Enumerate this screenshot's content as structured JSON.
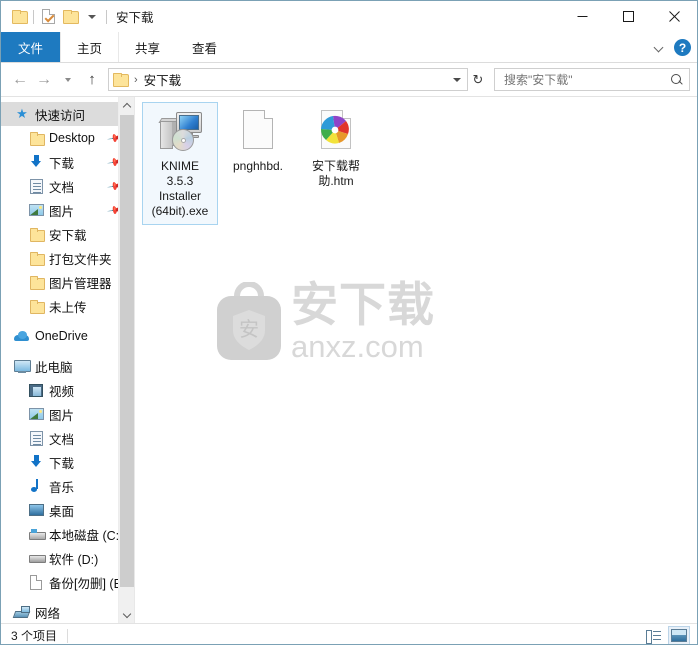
{
  "window": {
    "title": "安下载",
    "quick_access": [
      {
        "name": "folder-icon",
        "label": "文件夹"
      },
      {
        "name": "properties-icon",
        "label": "属性"
      },
      {
        "name": "new-folder-icon",
        "label": "新建文件夹"
      }
    ],
    "controls": {
      "minimize": "—",
      "maximize": "☐",
      "close": "✕"
    }
  },
  "ribbon": {
    "tabs": [
      {
        "label": "文件",
        "active": true
      },
      {
        "label": "主页",
        "active": false
      },
      {
        "label": "共享",
        "active": false
      },
      {
        "label": "查看",
        "active": false
      }
    ],
    "collapse_icon": "chevron-down-icon",
    "help_icon": "help-icon",
    "help_glyph": "?"
  },
  "navbar": {
    "back": "←",
    "forward": "→",
    "recent": "recent-locations-icon",
    "up": "↑",
    "breadcrumb": [
      "安下载"
    ],
    "breadcrumb_separator": "›",
    "dropdown_icon": "chevron-down-icon",
    "refresh_icon": "↻",
    "refresh_glyph": "↻"
  },
  "search": {
    "value": "",
    "placeholder": "搜索\"安下载\"",
    "icon": "search-icon"
  },
  "sidebar": {
    "items": [
      {
        "label": "快速访问",
        "icon": "star-pin-icon",
        "level": 0,
        "selected": true,
        "pinned": false
      },
      {
        "label": "Desktop",
        "icon": "folder-icon",
        "level": 1,
        "selected": false,
        "pinned": true
      },
      {
        "label": "下载",
        "icon": "downloads-icon",
        "level": 1,
        "selected": false,
        "pinned": true
      },
      {
        "label": "文档",
        "icon": "documents-icon",
        "level": 1,
        "selected": false,
        "pinned": true
      },
      {
        "label": "图片",
        "icon": "pictures-icon",
        "level": 1,
        "selected": false,
        "pinned": true
      },
      {
        "label": "安下载",
        "icon": "folder-icon",
        "level": 1,
        "selected": false,
        "pinned": false
      },
      {
        "label": "打包文件夹",
        "icon": "folder-icon",
        "level": 1,
        "selected": false,
        "pinned": false
      },
      {
        "label": "图片管理器",
        "icon": "folder-icon",
        "level": 1,
        "selected": false,
        "pinned": false
      },
      {
        "label": "未上传",
        "icon": "folder-icon",
        "level": 1,
        "selected": false,
        "pinned": false
      },
      {
        "label": "OneDrive",
        "icon": "onedrive-icon",
        "level": 0,
        "selected": false,
        "pinned": false
      },
      {
        "label": "此电脑",
        "icon": "this-pc-icon",
        "level": 0,
        "selected": false,
        "pinned": false
      },
      {
        "label": "视频",
        "icon": "videos-icon",
        "level": 1,
        "selected": false,
        "pinned": false
      },
      {
        "label": "图片",
        "icon": "pictures-icon",
        "level": 1,
        "selected": false,
        "pinned": false
      },
      {
        "label": "文档",
        "icon": "documents-icon",
        "level": 1,
        "selected": false,
        "pinned": false
      },
      {
        "label": "下载",
        "icon": "downloads-icon",
        "level": 1,
        "selected": false,
        "pinned": false
      },
      {
        "label": "音乐",
        "icon": "music-icon",
        "level": 1,
        "selected": false,
        "pinned": false
      },
      {
        "label": "桌面",
        "icon": "desktop-icon",
        "level": 1,
        "selected": false,
        "pinned": false
      },
      {
        "label": "本地磁盘 (C:)",
        "icon": "system-drive-icon",
        "level": 1,
        "selected": false,
        "pinned": false
      },
      {
        "label": "软件 (D:)",
        "icon": "drive-icon",
        "level": 1,
        "selected": false,
        "pinned": false
      },
      {
        "label": "备份[勿删] (E:",
        "icon": "drive-page-icon",
        "level": 1,
        "selected": false,
        "pinned": false
      },
      {
        "label": "网络",
        "icon": "network-icon",
        "level": 0,
        "selected": false,
        "pinned": false
      }
    ]
  },
  "files": [
    {
      "name": "KNIME\n3.5.3\nInstaller\n(64bit).exe",
      "icon": "exe-installer-icon",
      "selected": true
    },
    {
      "name": "pnghhbd.",
      "icon": "blank-document-icon",
      "selected": false
    },
    {
      "name": "安下载帮\n助.htm",
      "icon": "html-document-icon",
      "selected": false
    }
  ],
  "watermark": {
    "chinese": "安下载",
    "domain": "anxz.com",
    "logo_glyph": "安",
    "color": "#d8d8d8"
  },
  "statusbar": {
    "item_count": "3 个项目",
    "views": [
      {
        "name": "details-view-button",
        "icon": "details-view-icon",
        "active": false
      },
      {
        "name": "large-icons-view-button",
        "icon": "large-icons-view-icon",
        "active": true
      }
    ]
  },
  "colors": {
    "accent": "#1e7ac0",
    "window_border": "#7ba1b5",
    "selection": "#f2f8fd",
    "selection_border": "#a8d4f0",
    "sidebar_selected": "#dcdcdc"
  }
}
